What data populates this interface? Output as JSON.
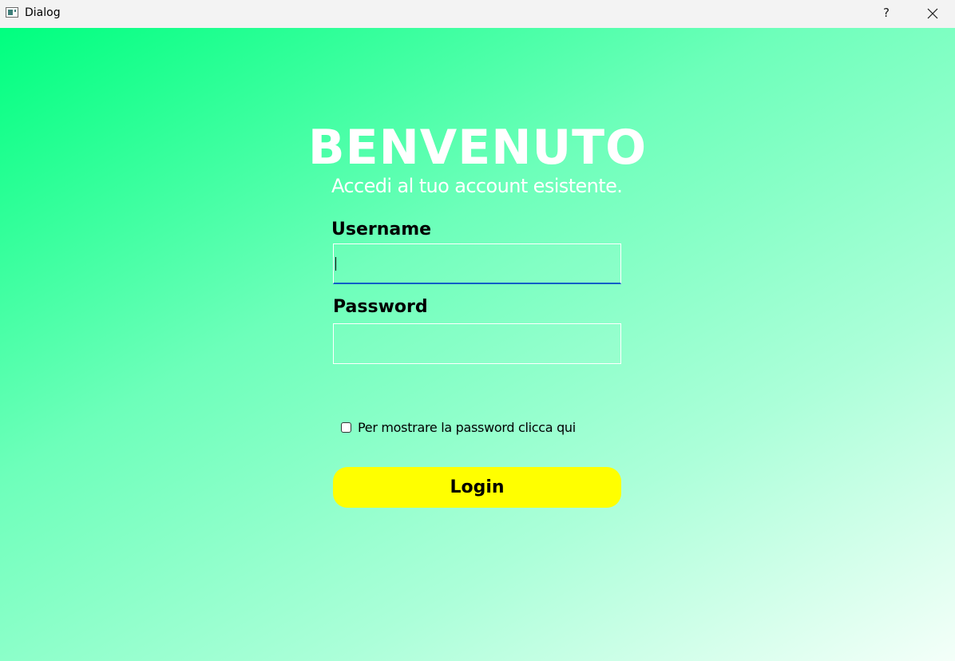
{
  "window": {
    "title": "Dialog",
    "help_label": "?",
    "icons": {
      "app": "app-window-icon",
      "close": "close-icon"
    }
  },
  "login": {
    "heading": "BENVENUTO",
    "subheading": "Accedi al tuo account esistente.",
    "username_label": "Username",
    "username_value": "",
    "password_label": "Password",
    "password_value": "",
    "show_password_label": "Per mostrare la password clicca qui",
    "show_password_checked": false,
    "login_button": "Login"
  },
  "colors": {
    "background_start": "#00ff7f",
    "background_end": "#f4fff9",
    "button": "#ffff00",
    "focus_underline": "#0b5fc7",
    "heading_text": "#ffffff"
  }
}
